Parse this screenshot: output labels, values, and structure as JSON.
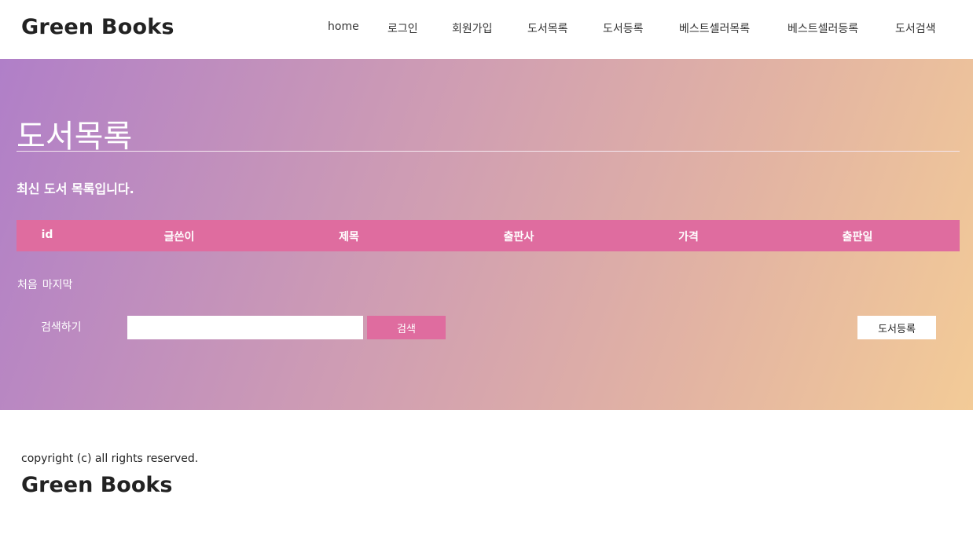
{
  "header": {
    "logo": "Green Books",
    "nav": [
      {
        "label": "home"
      },
      {
        "label": "로그인"
      },
      {
        "label": "회원가입"
      },
      {
        "label": "도서목록"
      },
      {
        "label": "도서등록"
      },
      {
        "label": "베스트셀러목록"
      },
      {
        "label": "베스트셀러등록"
      },
      {
        "label": "도서검색"
      }
    ]
  },
  "main": {
    "title": "도서목록",
    "subtitle": "최신 도서 목록입니다.",
    "table": {
      "columns": [
        "id",
        "글쓴이",
        "제목",
        "출판사",
        "가격",
        "출판일"
      ],
      "rows": []
    },
    "pager": {
      "first": "처음",
      "last": "마지막"
    },
    "search": {
      "label": "검색하기",
      "value": "",
      "button": "검색"
    },
    "register_button": "도서등록"
  },
  "footer": {
    "copyright": "copyright (c) all rights reserved.",
    "logo": "Green Books"
  },
  "colors": {
    "accent": "#df6c9f",
    "gradient_start": "#b07fc8",
    "gradient_end": "#f3cb97"
  }
}
